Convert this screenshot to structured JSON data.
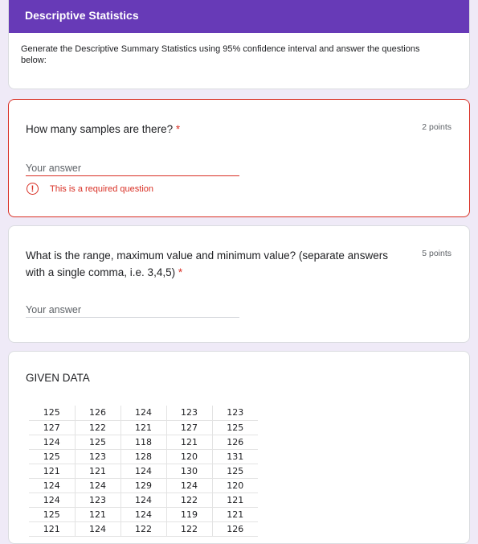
{
  "form": {
    "title": "Descriptive Statistics",
    "description": "Generate the Descriptive Summary Statistics using 95% confidence interval and answer the questions below:"
  },
  "questions": [
    {
      "title": "How many samples are there?",
      "required_mark": "*",
      "points": "2 points",
      "placeholder": "Your answer",
      "error": "This is a required question"
    },
    {
      "title": "What is the range, maximum value and minimum value? (separate answers with a single comma, i.e. 3,4,5)",
      "required_mark": "*",
      "points": "5 points",
      "placeholder": "Your answer"
    }
  ],
  "given": {
    "title": "GIVEN DATA",
    "rows": [
      [
        "125",
        "126",
        "124",
        "123",
        "123"
      ],
      [
        "127",
        "122",
        "121",
        "127",
        "125"
      ],
      [
        "124",
        "125",
        "118",
        "121",
        "126"
      ],
      [
        "125",
        "123",
        "128",
        "120",
        "131"
      ],
      [
        "121",
        "121",
        "124",
        "130",
        "125"
      ],
      [
        "124",
        "124",
        "129",
        "124",
        "120"
      ],
      [
        "124",
        "123",
        "124",
        "122",
        "121"
      ],
      [
        "125",
        "121",
        "124",
        "119",
        "121"
      ],
      [
        "121",
        "124",
        "122",
        "122",
        "126"
      ]
    ]
  },
  "colors": {
    "accent": "#673ab7",
    "error": "#d93025",
    "background": "#efeaf7"
  },
  "icons": {
    "error": "error-circle-icon"
  }
}
